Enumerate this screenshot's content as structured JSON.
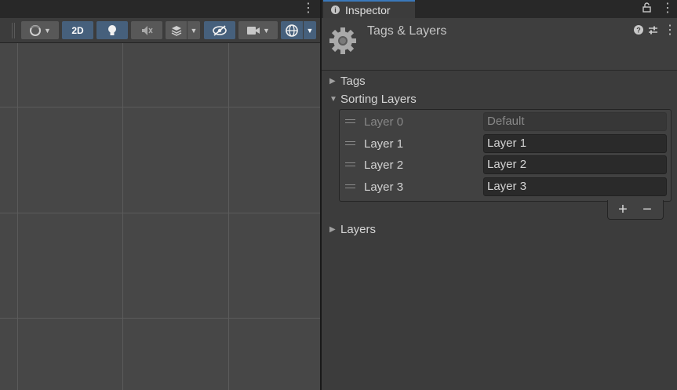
{
  "scene": {
    "toolbar": {
      "mode_2d_label": "2D",
      "colors": {
        "active": "#46607c",
        "button": "#585858"
      }
    }
  },
  "inspector": {
    "tab_label": "Inspector",
    "title": "Tags & Layers",
    "foldouts": {
      "tags": "Tags",
      "sorting_layers": "Sorting Layers",
      "layers": "Layers"
    },
    "sorting_layers": [
      {
        "label": "Layer 0",
        "value": "Default",
        "disabled": true
      },
      {
        "label": "Layer 1",
        "value": "Layer 1",
        "disabled": false
      },
      {
        "label": "Layer 2",
        "value": "Layer 2",
        "disabled": false
      },
      {
        "label": "Layer 3",
        "value": "Layer 3",
        "disabled": false
      }
    ],
    "add_label": "+",
    "remove_label": "−"
  }
}
